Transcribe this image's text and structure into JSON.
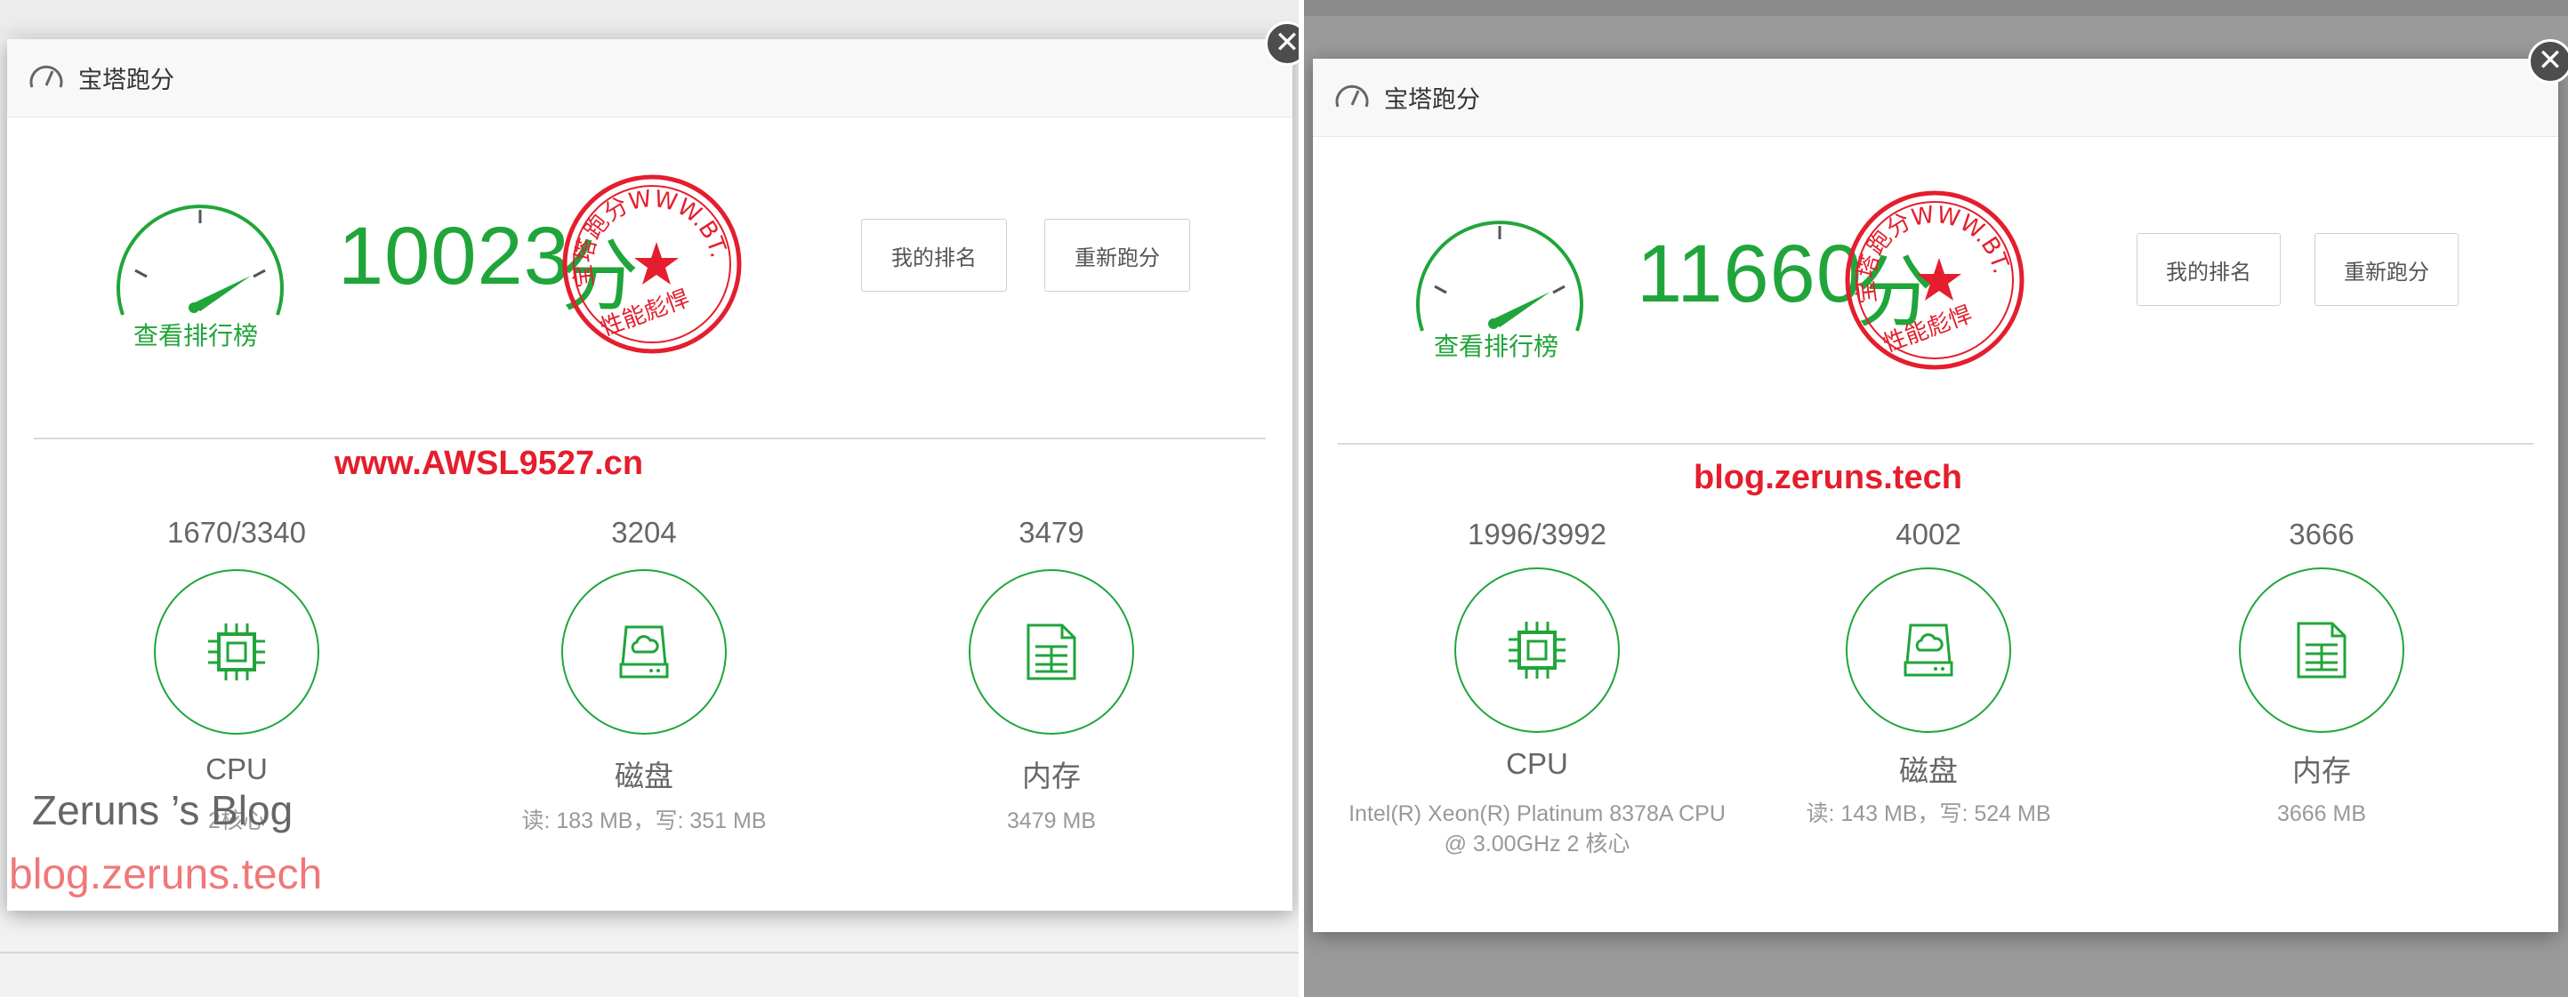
{
  "left": {
    "dialog_title": "宝塔跑分",
    "close_glyph": "✕",
    "rank_link": "查看排行榜",
    "score": "10023",
    "score_unit": "分",
    "buttons": {
      "my_rank": "我的排名",
      "rerun": "重新跑分"
    },
    "watermark": "www.AWSL9527.cn",
    "metrics": {
      "cpu": {
        "value": "1670/3340",
        "name": "CPU",
        "detail": "2核心"
      },
      "disk": {
        "value": "3204",
        "name": "磁盘",
        "detail": "读: 183 MB，写: 351 MB"
      },
      "memory": {
        "value": "3479",
        "name": "内存",
        "detail": "3479 MB"
      }
    },
    "blog_name": "Zeruns ’s Blog",
    "blog_url": "blog.zeruns.tech"
  },
  "right": {
    "dialog_title": "宝塔跑分",
    "close_glyph": "✕",
    "rank_link": "查看排行榜",
    "score": "11660",
    "score_unit": "分",
    "buttons": {
      "my_rank": "我的排名",
      "rerun": "重新跑分"
    },
    "watermark": "blog.zeruns.tech",
    "metrics": {
      "cpu": {
        "value": "1996/3992",
        "name": "CPU",
        "detail_line1": "Intel(R) Xeon(R) Platinum 8378A CPU",
        "detail_line2": "@ 3.00GHz 2 核心"
      },
      "disk": {
        "value": "4002",
        "name": "磁盘",
        "detail": "读: 143 MB，写: 524 MB"
      },
      "memory": {
        "value": "3666",
        "name": "内存",
        "detail": "3666 MB"
      }
    }
  },
  "stamp": {
    "ring_text": "宝塔跑分WWW.BT.CN",
    "bottom_text": "性能彪悍"
  },
  "icons": [
    "speedometer-icon",
    "cpu-chip-icon",
    "disk-drive-icon",
    "memory-card-icon",
    "close-icon",
    "stamp-star-icon"
  ],
  "colors": {
    "accent": "#20a53a",
    "stamp": "#e41e2d",
    "watermark": "#e41e2d",
    "blog_url": "#f07878"
  }
}
